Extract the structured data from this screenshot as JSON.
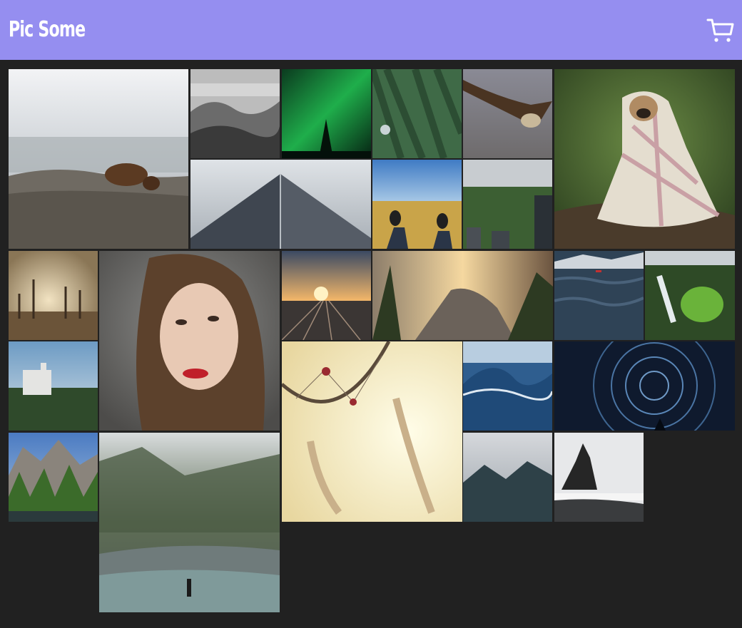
{
  "header": {
    "title": "Pic Some",
    "cart_icon": "shopping-cart-icon",
    "background": "#958ef0"
  },
  "gallery": {
    "background": "#212121",
    "photos": [
      {
        "name": "photo-bear-on-rocks"
      },
      {
        "name": "photo-foggy-forest-bw"
      },
      {
        "name": "photo-aurora-green"
      },
      {
        "name": "photo-hummingbird-pines"
      },
      {
        "name": "photo-vulture-flying"
      },
      {
        "name": "photo-pug-in-blanket"
      },
      {
        "name": "photo-skyscraper-looking-up"
      },
      {
        "name": "photo-feet-in-field"
      },
      {
        "name": "photo-central-park-city"
      },
      {
        "name": "photo-dead-trees-sunset"
      },
      {
        "name": "photo-woman-portrait"
      },
      {
        "name": "photo-rail-yard-sunset"
      },
      {
        "name": "photo-half-dome-sunset"
      },
      {
        "name": "photo-ocean-boat"
      },
      {
        "name": "photo-waterfall-green"
      },
      {
        "name": "photo-castle-neuschwanstein"
      },
      {
        "name": "photo-dreamcatcher"
      },
      {
        "name": "photo-ocean-wave"
      },
      {
        "name": "photo-star-trails"
      },
      {
        "name": "photo-yosemite-river"
      },
      {
        "name": "photo-misty-river-forest"
      },
      {
        "name": "photo-foggy-mountain"
      },
      {
        "name": "photo-sea-stack-beach"
      }
    ]
  }
}
